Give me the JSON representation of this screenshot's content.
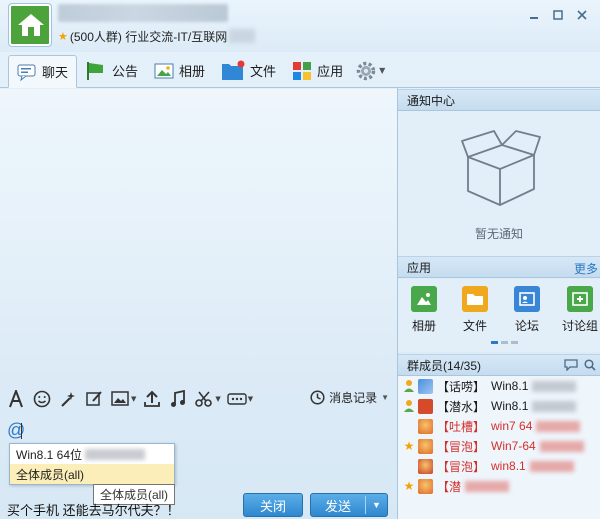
{
  "titlebar": {
    "group_name": "",
    "group_info": "(500人群) 行业交流-IT/互联网",
    "controls": [
      "minimize",
      "maximize",
      "close"
    ]
  },
  "tabs": [
    {
      "label": "聊天",
      "icon": "chat-icon",
      "active": true
    },
    {
      "label": "公告",
      "icon": "announcement-icon",
      "active": false
    },
    {
      "label": "相册",
      "icon": "album-icon",
      "active": false
    },
    {
      "label": "文件",
      "icon": "file-icon",
      "active": false
    },
    {
      "label": "应用",
      "icon": "apps-icon",
      "active": false
    }
  ],
  "input_toolbar": {
    "history_label": "消息记录"
  },
  "input": {
    "at_symbol": "@",
    "mention_options": [
      "Win8.1 64位",
      "全体成员(all)"
    ],
    "tooltip": "全体成员(all)",
    "typed_text": "买个手机 还能去马尔代夫？！"
  },
  "buttons": {
    "close": "关闭",
    "send": "发送"
  },
  "notice": {
    "title": "通知中心",
    "empty_text": "暂无通知"
  },
  "apps": {
    "title": "应用",
    "more": "更多",
    "items": [
      {
        "label": "相册",
        "color": "#48a84a"
      },
      {
        "label": "文件",
        "color": "#f0a81e"
      },
      {
        "label": "论坛",
        "color": "#3a86d6"
      },
      {
        "label": "讨论组",
        "color": "#48a84a"
      }
    ]
  },
  "members": {
    "title": "群成员(14/35)",
    "list": [
      {
        "tag": "【话唠】",
        "name": "Win8.1",
        "red": false,
        "role": "owner-icon"
      },
      {
        "tag": "【潜水】",
        "name": "Win8.1",
        "red": false,
        "role": "owner-icon"
      },
      {
        "tag": "【吐槽】",
        "name": "win7 64",
        "red": true,
        "role": "none"
      },
      {
        "tag": "【冒泡】",
        "name": "Win7-64",
        "red": true,
        "role": "admin-star-icon"
      },
      {
        "tag": "【冒泡】",
        "name": "win8.1",
        "red": true,
        "role": "none"
      },
      {
        "tag": "【潜",
        "name": "",
        "red": true,
        "role": "admin-star-icon"
      }
    ]
  }
}
